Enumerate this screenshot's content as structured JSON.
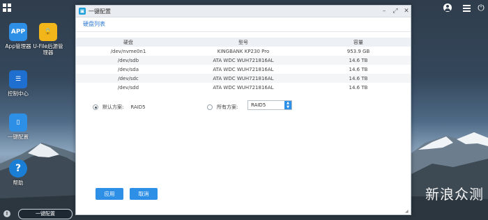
{
  "desktop": {
    "icons": [
      {
        "label": "App管理器"
      },
      {
        "label": "U-File后源管理器"
      },
      {
        "label": "控制中心"
      },
      {
        "label": "一键配置"
      },
      {
        "label": "帮助"
      }
    ]
  },
  "taskbar": {
    "active_item": "一键配置"
  },
  "watermark": "新浪众测",
  "window": {
    "title": "一键配置",
    "section_title": "硬盘列表",
    "table": {
      "headers": [
        "硬盘",
        "型号",
        "容量"
      ],
      "rows": [
        [
          "/dev/nvme0n1",
          "KINGBANK KP230 Pro",
          "953.9 GB"
        ],
        [
          "/dev/sdb",
          "ATA WDC WUH721816AL",
          "14.6 TB"
        ],
        [
          "/dev/sda",
          "ATA WDC WUH721816AL",
          "14.6 TB"
        ],
        [
          "/dev/sdc",
          "ATA WDC WUH721816AL",
          "14.6 TB"
        ],
        [
          "/dev/sdd",
          "ATA WDC WUH721816AL",
          "14.6 TB"
        ]
      ]
    },
    "default_option": {
      "label": "默认方案:",
      "value": "RAID5",
      "selected": true
    },
    "all_option": {
      "label": "所有方案:",
      "selected": false
    },
    "raid_select": {
      "value": "RAID5"
    },
    "buttons": {
      "apply": "应用",
      "cancel": "取消"
    }
  }
}
